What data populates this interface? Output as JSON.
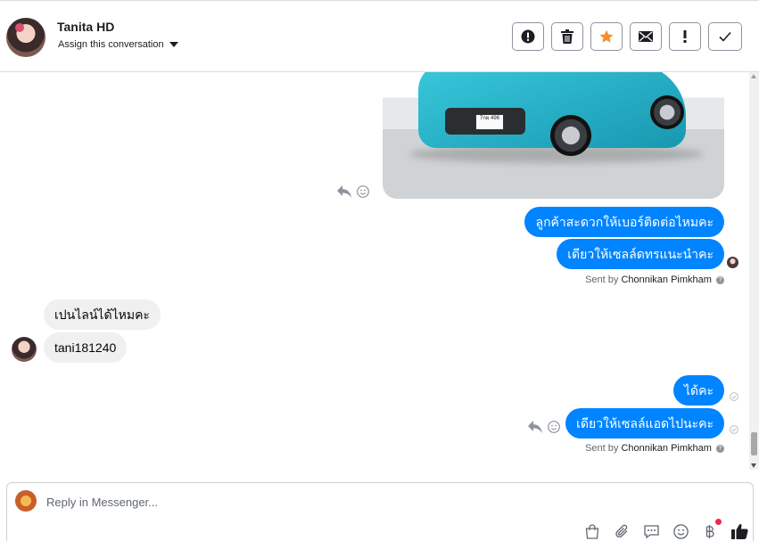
{
  "header": {
    "contact_name": "Tanita HD",
    "assign_label": "Assign this conversation",
    "actions": [
      {
        "name": "mark-spam-button",
        "icon": "alert-circle-icon"
      },
      {
        "name": "delete-button",
        "icon": "trash-icon"
      },
      {
        "name": "star-button",
        "icon": "star-icon"
      },
      {
        "name": "mark-unread-button",
        "icon": "envelope-icon"
      },
      {
        "name": "follow-up-button",
        "icon": "exclamation-icon"
      },
      {
        "name": "mark-done-button",
        "icon": "checkmark-icon"
      }
    ],
    "star_color": "#f5902a"
  },
  "thread": {
    "plate_text": "7กผ 496",
    "messages_out_1": [
      "ลูกค้าสะดวกให้เบอร์ติดต่อไหมคะ",
      "เดียวให้เซลล์ดทรแนะนำคะ"
    ],
    "sent_by_prefix_1": "Sent by",
    "sent_by_name_1": "Chonnikan Pimkham",
    "messages_in": [
      "เปนไลน์ได้ไหมคะ",
      "tani181240"
    ],
    "messages_out_2": [
      "ได้คะ",
      "เดียวให้เซลล์แอดไปนะคะ"
    ],
    "sent_by_prefix_2": "Sent by",
    "sent_by_name_2": "Chonnikan Pimkham",
    "question_mark": "?",
    "accent_color": "#0084ff"
  },
  "composer": {
    "placeholder": "Reply in Messenger...",
    "tools": [
      "shop-bag-icon",
      "paperclip-icon",
      "speech-bubble-icon",
      "emoji-icon",
      "baht-payment-icon",
      "thumbs-up-icon"
    ]
  }
}
